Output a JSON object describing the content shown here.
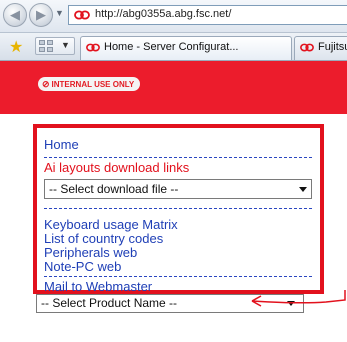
{
  "browser": {
    "url": "http://abg0355a.abg.fsc.net/",
    "tabs": [
      {
        "label": "Home - Server Configurat...",
        "active": true
      },
      {
        "label": "Fujitsu",
        "active": false
      }
    ]
  },
  "header": {
    "badge_label": "INTERNAL USE ONLY"
  },
  "nav": {
    "home": "Home",
    "ai_layouts": "Ai layouts download links",
    "download_select": "-- Select download file --",
    "keyboard_matrix": "Keyboard usage Matrix",
    "country_codes": "List of country codes",
    "peripherals": "Peripherals web",
    "note_pc": "Note-PC web",
    "mail_webmaster": "Mail to Webmaster"
  },
  "product_select": "-- Select Product Name --",
  "colors": {
    "brand_red": "#ec1c2c",
    "link_blue": "#1f3fb6",
    "highlight_red": "#e2111d"
  }
}
